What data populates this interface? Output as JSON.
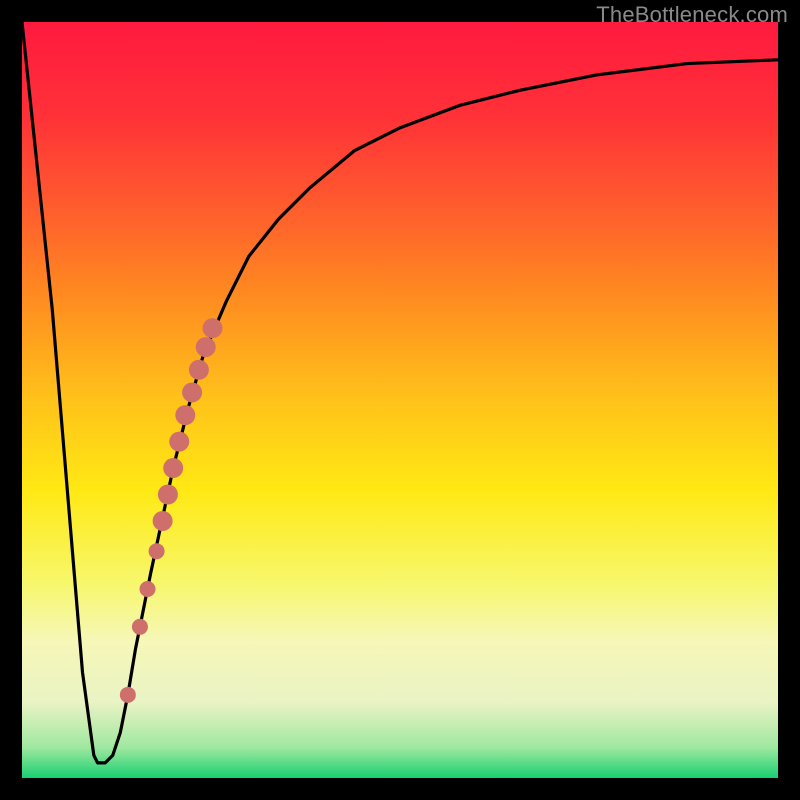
{
  "watermark": "TheBottleneck.com",
  "chart_data": {
    "type": "line",
    "title": "",
    "xlabel": "",
    "ylabel": "",
    "ylim": [
      0,
      100
    ],
    "xlim": [
      0,
      100
    ],
    "series": [
      {
        "name": "curve",
        "x": [
          0,
          4,
          8,
          9.5,
          10,
          11,
          12,
          13,
          14,
          15,
          16,
          17,
          18.5,
          20,
          22,
          24,
          27,
          30,
          34,
          38,
          44,
          50,
          58,
          66,
          76,
          88,
          100
        ],
        "y": [
          100,
          62,
          14,
          3,
          2,
          2,
          3,
          6,
          11,
          17,
          22,
          27,
          34,
          41,
          49,
          56,
          63,
          69,
          74,
          78,
          83,
          86,
          89,
          91,
          93,
          94.5,
          95
        ]
      }
    ],
    "markers": [
      {
        "x": 14.0,
        "y": 11,
        "r": 8
      },
      {
        "x": 15.6,
        "y": 20,
        "r": 8
      },
      {
        "x": 16.6,
        "y": 25,
        "r": 8
      },
      {
        "x": 17.8,
        "y": 30,
        "r": 8
      },
      {
        "x": 18.6,
        "y": 34,
        "r": 10
      },
      {
        "x": 19.3,
        "y": 37.5,
        "r": 10
      },
      {
        "x": 20.0,
        "y": 41,
        "r": 10
      },
      {
        "x": 20.8,
        "y": 44.5,
        "r": 10
      },
      {
        "x": 21.6,
        "y": 48,
        "r": 10
      },
      {
        "x": 22.5,
        "y": 51,
        "r": 10
      },
      {
        "x": 23.4,
        "y": 54,
        "r": 10
      },
      {
        "x": 24.3,
        "y": 57,
        "r": 10
      },
      {
        "x": 25.2,
        "y": 59.5,
        "r": 10
      }
    ],
    "gradient_stops": [
      {
        "offset": 0.0,
        "color": "#ff1a3f"
      },
      {
        "offset": 0.12,
        "color": "#ff3038"
      },
      {
        "offset": 0.24,
        "color": "#ff5a2e"
      },
      {
        "offset": 0.36,
        "color": "#ff8a20"
      },
      {
        "offset": 0.5,
        "color": "#ffc21a"
      },
      {
        "offset": 0.62,
        "color": "#ffe914"
      },
      {
        "offset": 0.74,
        "color": "#f7f76a"
      },
      {
        "offset": 0.82,
        "color": "#f6f7b8"
      },
      {
        "offset": 0.9,
        "color": "#e9f3c4"
      },
      {
        "offset": 0.96,
        "color": "#9fe8a0"
      },
      {
        "offset": 1.0,
        "color": "#17d070"
      }
    ],
    "curve_color": "#000000",
    "marker_color": "#cf6f6c"
  }
}
